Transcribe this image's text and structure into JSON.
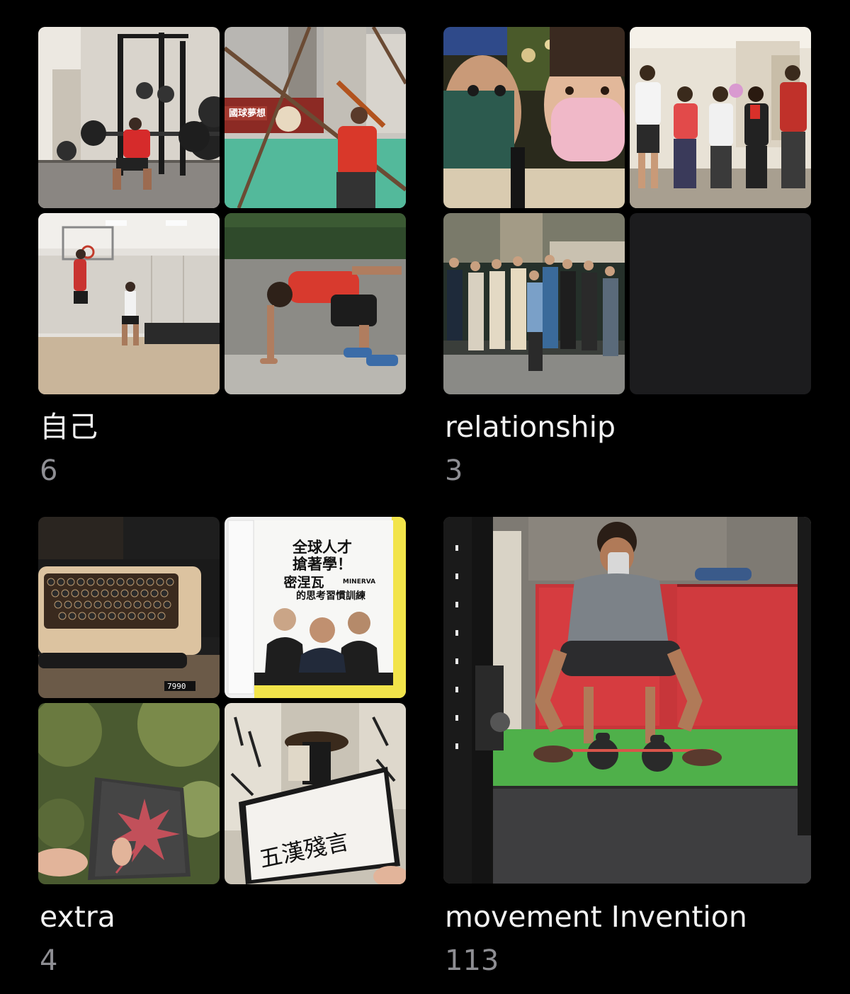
{
  "colors": {
    "background": "#000000",
    "title": "#f2f2f2",
    "count": "#8e8e93",
    "empty_tile": "#1c1c1e"
  },
  "albums": [
    {
      "title": "自己",
      "count": "6",
      "thumbnails": [
        "gym-squat-photo",
        "batting-cage-photo",
        "basketball-court-photo",
        "sprint-start-photo"
      ]
    },
    {
      "title": "relationship",
      "count": "3",
      "thumbnails": [
        "couple-selfie-photo",
        "family-group-photo",
        "friends-group-photo",
        "empty"
      ]
    },
    {
      "title": "extra",
      "count": "4",
      "thumbnails": [
        "retro-keyboard-photo",
        "book-cover-photo",
        "maple-leaf-photo",
        "calligraphy-photo"
      ]
    },
    {
      "title": "movement Invention",
      "count": "113",
      "thumbnails": [
        "kettlebell-mirror-selfie-photo"
      ]
    }
  ],
  "book": {
    "title_line1": "全球人才",
    "title_line2": "搶著學！",
    "title_line3": "密涅瓦",
    "title_line4": "的思考習慣訓練",
    "brand": "MINERVA"
  },
  "mural": {
    "sign_text": "國球夢想"
  },
  "calligraphy": {
    "text": "五漢殘言"
  },
  "keyboard": {
    "price_tag": "7990"
  }
}
